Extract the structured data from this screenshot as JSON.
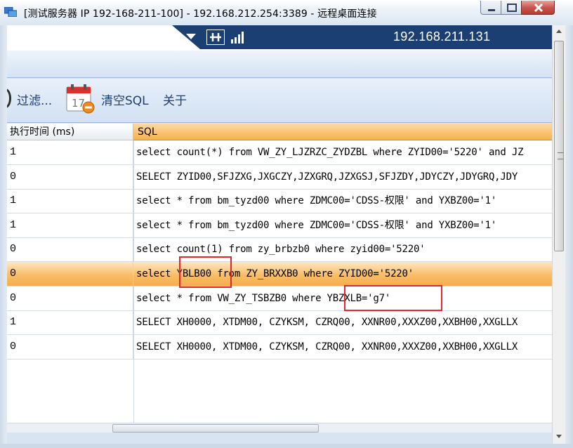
{
  "window": {
    "title": "[测试服务器 IP 192-168-211-100] - 192.168.212.254:3389 - 远程桌面连接"
  },
  "rdp_bar": {
    "host": "192.168.211.131"
  },
  "toolbar": {
    "filter_label": "过滤...",
    "calendar_day": "17",
    "clear_sql_label": "清空SQL",
    "about_label": "关于"
  },
  "grid": {
    "columns": [
      "执行时间 (ms)",
      "SQL"
    ],
    "rows": [
      {
        "time": "1",
        "sql": "select count(*) from VW_ZY_LJZRZC_ZYDZBL where ZYID00='5220' and JZ"
      },
      {
        "time": "0",
        "sql": "SELECT ZYID00,SFJZXG,JXGCZY,JZXGRQ,JZXGSJ,SFJZDY,JDYCZY,JDYGRQ,JDY"
      },
      {
        "time": "1",
        "sql": "select * from bm_tyzd00 where ZDMC00='CDSS-权限' and YXBZ00='1'"
      },
      {
        "time": "1",
        "sql": "select * from bm_tyzd00 where ZDMC00='CDSS-权限' and YXBZ00='1'"
      },
      {
        "time": "0",
        "sql": "select count(1) from zy_brbzb0 where zyid00='5220'"
      },
      {
        "time": "0",
        "sql": "select YBLB00 from ZY_BRXXB0 where ZYID00='5220'",
        "selected": true
      },
      {
        "time": "0",
        "sql": "select * from VW_ZY_TSBZB0 where YBZXLB='g7'"
      },
      {
        "time": "1",
        "sql": "SELECT XH0000, XTDM00, CZYKSM, CZRQ00, XXNR00,XXXZ00,XXBH00,XXGLLX"
      },
      {
        "time": "0",
        "sql": "SELECT XH0000, XTDM00, CZYKSM, CZRQ00, XXNR00,XXXZ00,XXBH00,XXGLLX"
      }
    ]
  },
  "colors": {
    "selected_row": "#f8bd68",
    "highlight_box": "#e5262a",
    "rdp_bar": "#1b3e73"
  }
}
